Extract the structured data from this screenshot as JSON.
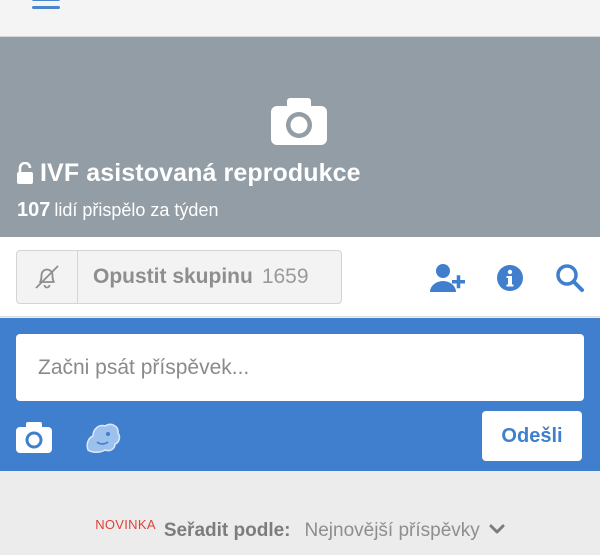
{
  "group": {
    "name": "IVF asistovaná reprodukce",
    "weekly_contributors": "107",
    "contributors_text": "lidí přispělo za týden",
    "leave_label": "Opustit skupinu",
    "member_count": "1659"
  },
  "composer": {
    "placeholder": "Začni psát příspěvek...",
    "send_label": "Odešli"
  },
  "sort": {
    "badge": "NOVINKA",
    "label": "Seřadit podle:",
    "value": "Nejnovější příspěvky"
  },
  "colors": {
    "cover": "#939da5",
    "accent": "#3f7fce",
    "badge": "#e0413a"
  },
  "icons": [
    "menu-icon",
    "camera-icon",
    "unlock-icon",
    "bell-off-icon",
    "add-user-icon",
    "info-icon",
    "search-icon",
    "sticker-icon",
    "chevron-down-icon"
  ]
}
